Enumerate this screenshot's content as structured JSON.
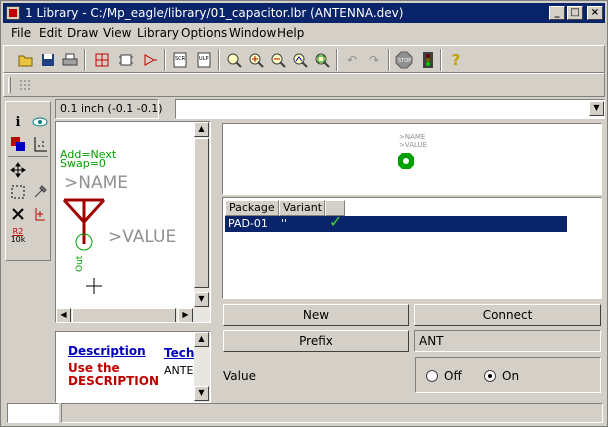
{
  "window": {
    "title": "1 Library - C:/Mp_eagle/library/01_capacitor.lbr (ANTENNA.dev)",
    "minimize": "_",
    "maximize": "□",
    "close": "×"
  },
  "menu": [
    "File",
    "Edit",
    "Draw",
    "View",
    "Library",
    "Options",
    "Window",
    "Help"
  ],
  "toolbar": {
    "icons": [
      "open-icon",
      "save-icon",
      "print-icon",
      "device-icon",
      "package-icon",
      "symbol-icon",
      "script-icon",
      "ulp-icon",
      "zoom-fit-icon",
      "zoom-in-icon",
      "zoom-out-icon",
      "zoom-redraw-icon",
      "zoom-select-icon",
      "undo-icon",
      "redo-icon",
      "stop-icon",
      "go-icon",
      "help-icon"
    ],
    "stop_label": "STOP",
    "help_label": "?"
  },
  "coord": {
    "readout": "0.1 inch (-0.1 -0.1)"
  },
  "symbol": {
    "addlevel": "Add=Next",
    "swaplevel": "Swap=0",
    "name": ">NAME",
    "value": ">VALUE",
    "pin": "Out"
  },
  "description": {
    "heading": "Description",
    "text": "Use the DESCRIPTION",
    "tech_heading": "Tech",
    "tech_value": "ANTE"
  },
  "preview": {
    "name": ">NAME",
    "value": ">VALUE"
  },
  "packages": {
    "columns": [
      "Package",
      "Variant"
    ],
    "rows": [
      {
        "package": "PAD-01",
        "variant": "''",
        "check": "✓"
      }
    ]
  },
  "buttons": {
    "new": "New",
    "connect": "Connect",
    "prefix": "Prefix"
  },
  "prefix_value": "ANT",
  "value_group": {
    "label": "Value",
    "off": "Off",
    "on": "On",
    "selected": "On"
  },
  "palette": {
    "info_icon": "i",
    "r2_label": "R2",
    "r2_sub": "10k"
  }
}
